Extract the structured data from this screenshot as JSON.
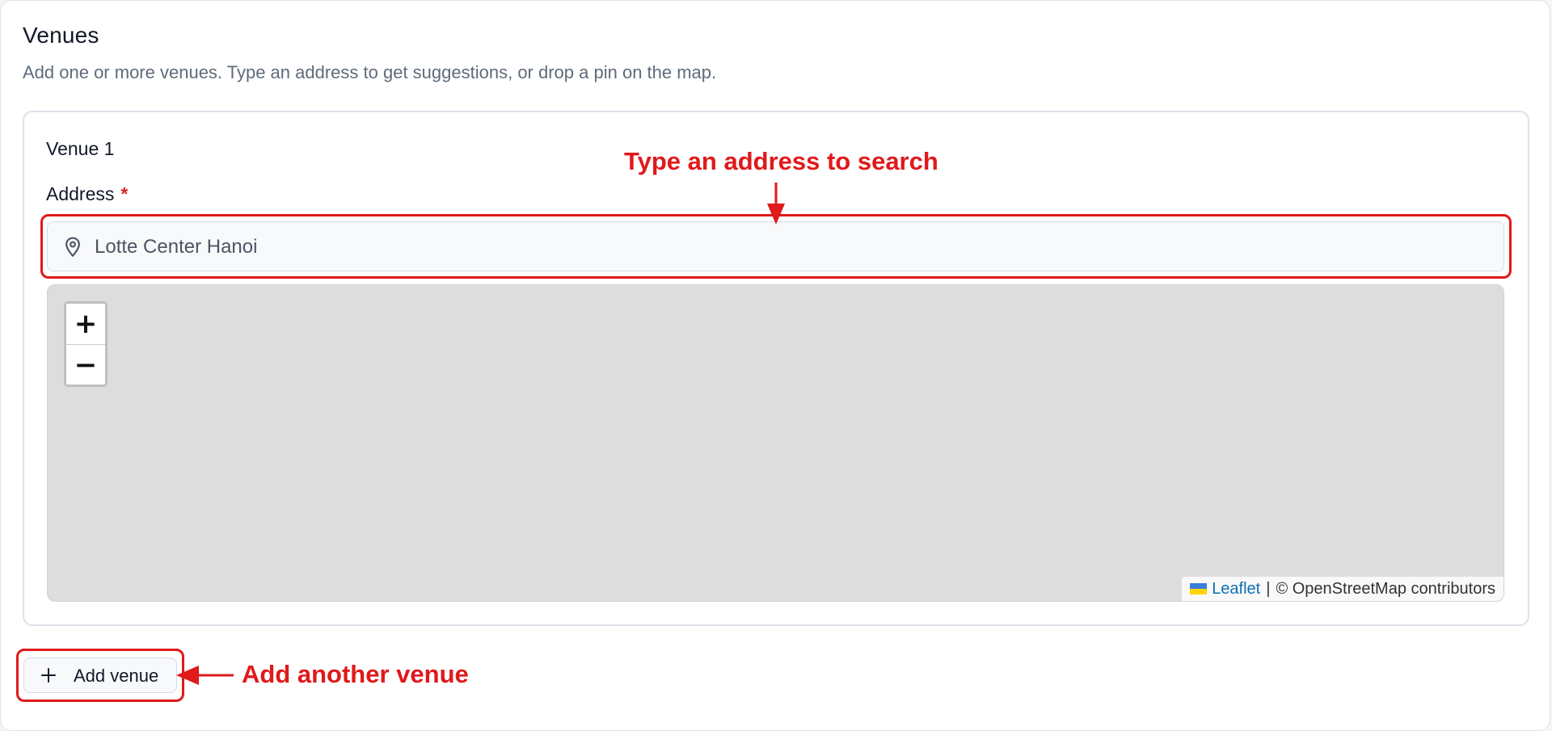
{
  "section": {
    "title": "Venues",
    "description": "Add one or more venues. Type an address to get suggestions, or drop a pin on the map."
  },
  "venue": {
    "label": "Venue 1",
    "address_label": "Address",
    "required_mark": "*",
    "address_value": "Lotte Center Hanoi",
    "address_icon": "map-pin-icon"
  },
  "map": {
    "zoom_in": "+",
    "zoom_out": "−",
    "attribution": {
      "leaflet": "Leaflet",
      "separator": "|",
      "osm": "© OpenStreetMap contributors"
    },
    "background_color": "#dddddd"
  },
  "actions": {
    "add_venue_label": "Add venue",
    "add_venue_icon": "plus-icon"
  },
  "annotations": {
    "search_hint": "Type an address to search",
    "add_hint": "Add another venue",
    "color": "#e0191b"
  }
}
